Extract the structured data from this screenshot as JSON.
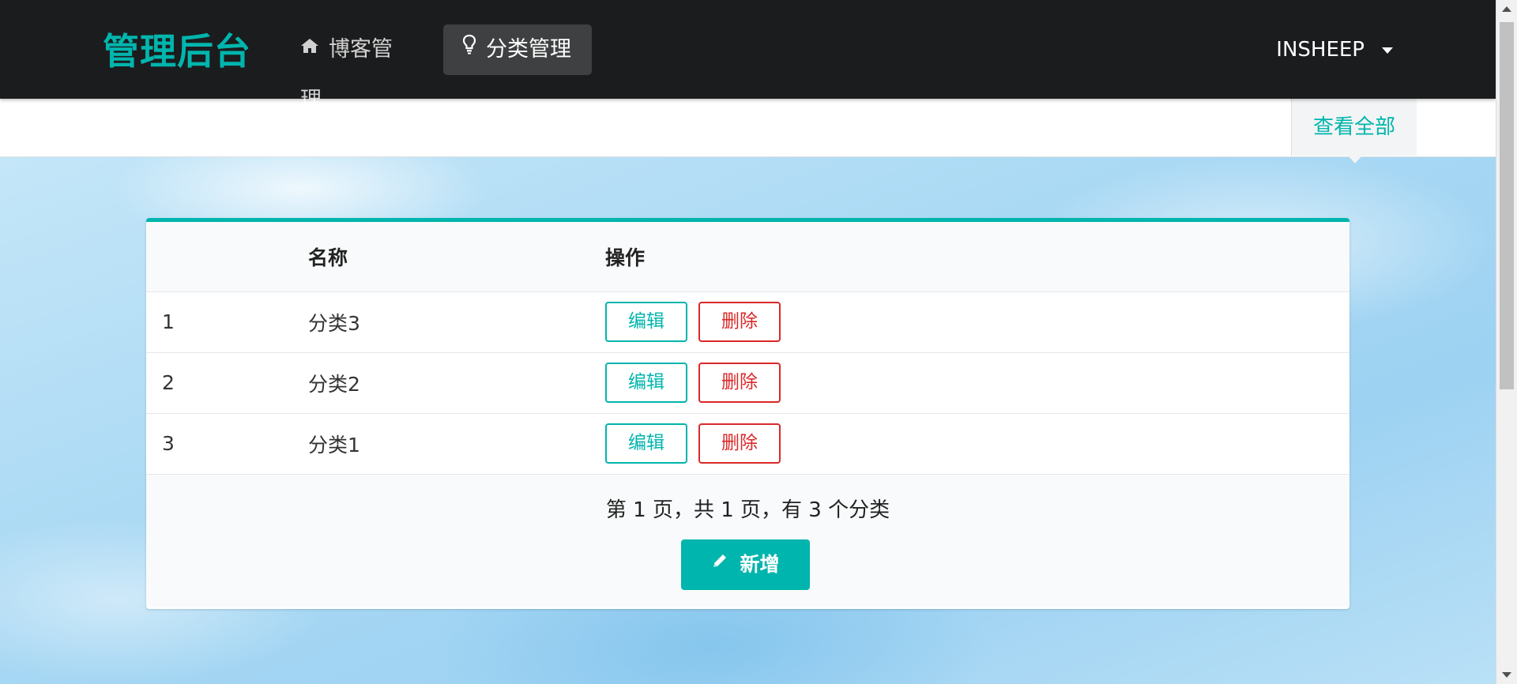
{
  "navbar": {
    "brand": "管理后台",
    "items": [
      {
        "label": "博客管理",
        "icon": "home-icon"
      },
      {
        "label": "分类管理",
        "icon": "lightbulb-icon",
        "active": true
      }
    ],
    "user": {
      "name": "INSHEEP"
    }
  },
  "subnav": {
    "view_all": "查看全部"
  },
  "table": {
    "headers": [
      "",
      "名称",
      "操作"
    ],
    "rows": [
      {
        "index": "1",
        "name": "分类3",
        "edit": "编辑",
        "delete": "删除"
      },
      {
        "index": "2",
        "name": "分类2",
        "edit": "编辑",
        "delete": "删除"
      },
      {
        "index": "3",
        "name": "分类1",
        "edit": "编辑",
        "delete": "删除"
      }
    ]
  },
  "footer": {
    "page_info": "第 1 页，共 1 页，有 3 个分类",
    "add_button": "新增"
  },
  "colors": {
    "accent": "#00b5ad",
    "danger": "#db2828",
    "navbar_bg": "#1b1c1d"
  }
}
